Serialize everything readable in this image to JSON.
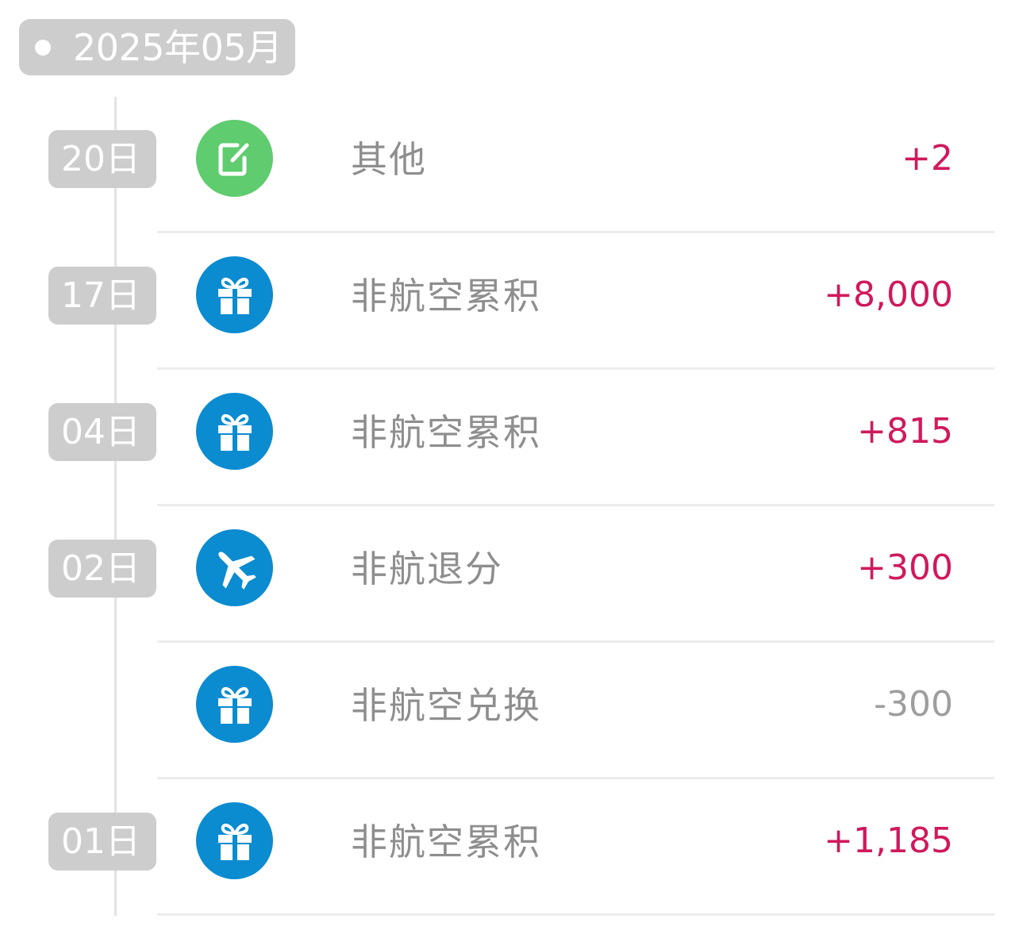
{
  "header": {
    "month_label": "2025年05月"
  },
  "colors": {
    "positive_amount": "#d0195d",
    "negative_amount": "#9e9e9e",
    "icon_blue": "#0b8bd0",
    "icon_green": "#5fcc6f",
    "badge_gray": "#cdcdcd"
  },
  "entries": [
    {
      "day": "20日",
      "icon": "edit-note-icon",
      "title": "其他",
      "amount": "+2"
    },
    {
      "day": "17日",
      "icon": "gift-icon",
      "title": "非航空累积",
      "amount": "+8,000"
    },
    {
      "day": "04日",
      "icon": "gift-icon",
      "title": "非航空累积",
      "amount": "+815"
    },
    {
      "day": "02日",
      "icon": "airplane-icon",
      "title": "非航退分",
      "amount": "+300"
    },
    {
      "day": "",
      "icon": "gift-icon",
      "title": "非航空兑换",
      "amount": "-300"
    },
    {
      "day": "01日",
      "icon": "gift-icon",
      "title": "非航空累积",
      "amount": "+1,185"
    }
  ]
}
